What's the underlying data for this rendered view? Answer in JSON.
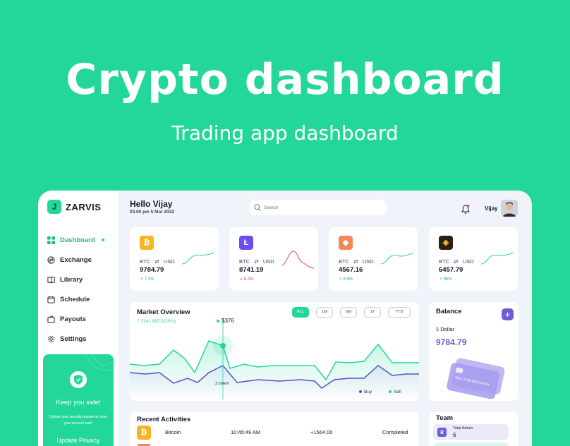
{
  "hero": {
    "title": "Crypto dashboard",
    "subtitle": "Trading app dashboard"
  },
  "brand": {
    "name": "ZARVIS",
    "accent": "#23d79a",
    "purple": "#6c5dd3"
  },
  "sidebar": {
    "items": [
      {
        "label": "Dashboard",
        "icon": "grid-icon",
        "active": true
      },
      {
        "label": "Exchange",
        "icon": "exchange-icon"
      },
      {
        "label": "Library",
        "icon": "book-icon"
      },
      {
        "label": "Schedule",
        "icon": "calendar-icon"
      },
      {
        "label": "Payouts",
        "icon": "wallet-icon"
      },
      {
        "label": "Settings",
        "icon": "gear-icon"
      }
    ],
    "safe_card": {
      "title": "Keep you safe!",
      "text": "Update your security password, keep your account safe!",
      "button": "Update Privacy"
    }
  },
  "header": {
    "greeting": "Hello Vijay",
    "datetime": "03.00 pm 5 Mar 2022",
    "search_placeholder": "Search",
    "user_name": "Vijay"
  },
  "cards": [
    {
      "pair_base": "BTC",
      "arrow": "⇄",
      "pair_quote": "USD",
      "price": "9784.79",
      "change": "7.2%",
      "trend": "up",
      "coin_color": "#f7b523",
      "coin_symbol": "₿"
    },
    {
      "pair_base": "BTC",
      "arrow": "⇄",
      "pair_quote": "USD",
      "price": "8741.19",
      "change": "5.2%",
      "trend": "down",
      "coin_color": "#6c4cf1",
      "coin_symbol": "Ł"
    },
    {
      "pair_base": "BTC",
      "arrow": "⇄",
      "pair_quote": "USD",
      "price": "4567.16",
      "change": "6.5%",
      "trend": "up",
      "coin_color": "#f2875c",
      "coin_symbol": "◆"
    },
    {
      "pair_base": "BTC",
      "arrow": "⇄",
      "pair_quote": "USD",
      "price": "6457.79",
      "change": "95%",
      "trend": "up",
      "coin_color": "#2a2114",
      "coin_symbol": "◈"
    }
  ],
  "market": {
    "title": "Market Overview",
    "subtitle": "7.2141.997.5(25%)",
    "ranges": [
      "ALL",
      "1M",
      "6M",
      "1Y",
      "YTD"
    ],
    "active_range": "ALL",
    "tooltip_value": "$376",
    "tooltip_time": "3:59AM",
    "legend": [
      {
        "label": "Buy",
        "color": "#5b4fc9"
      },
      {
        "label": "Sell",
        "color": "#23d79a"
      }
    ]
  },
  "balance": {
    "title": "Balance",
    "plus": "+",
    "currency_symbol": "$",
    "currency_label": "Dollar",
    "value": "9784.79"
  },
  "activities": {
    "title": "Recent Activities",
    "rows": [
      {
        "name": "Bitcoin",
        "time": "10:45:49 AM",
        "amount": "+1564,00",
        "status": "Completed"
      }
    ]
  },
  "team": {
    "title": "Team",
    "items": [
      {
        "role": "Total Admin",
        "count": "6"
      }
    ]
  }
}
